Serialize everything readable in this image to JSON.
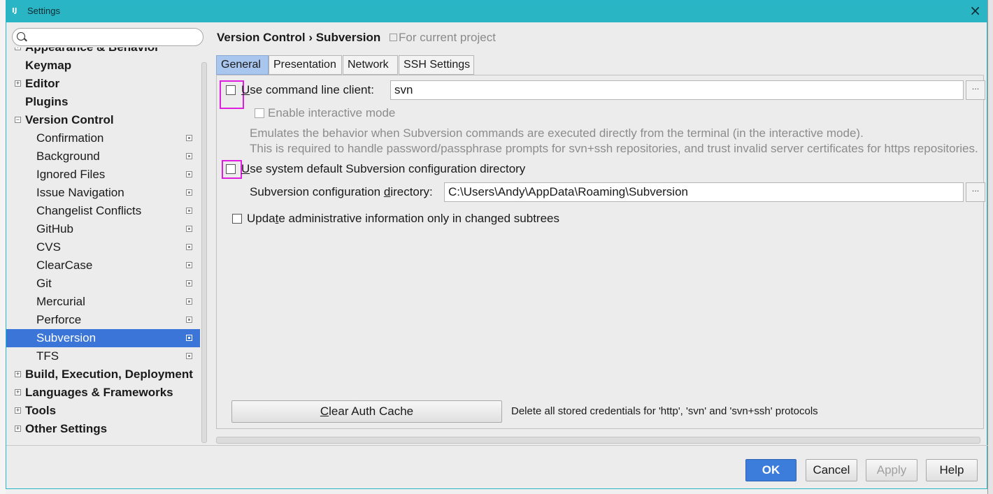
{
  "window": {
    "title": "Settings",
    "close": "×"
  },
  "search": {
    "placeholder": "",
    "value": ""
  },
  "tree": {
    "items": [
      {
        "label": "Appearance & Behavior",
        "bold": true,
        "expander": "+"
      },
      {
        "label": "Keymap",
        "bold": true
      },
      {
        "label": "Editor",
        "bold": true,
        "expander": "+"
      },
      {
        "label": "Plugins",
        "bold": true
      },
      {
        "label": "Version Control",
        "bold": true,
        "expander": "−"
      },
      {
        "label": "Confirmation"
      },
      {
        "label": "Background"
      },
      {
        "label": "Ignored Files"
      },
      {
        "label": "Issue Navigation"
      },
      {
        "label": "Changelist Conflicts"
      },
      {
        "label": "GitHub"
      },
      {
        "label": "CVS"
      },
      {
        "label": "ClearCase"
      },
      {
        "label": "Git"
      },
      {
        "label": "Mercurial"
      },
      {
        "label": "Perforce"
      },
      {
        "label": "Subversion",
        "selected": true
      },
      {
        "label": "TFS"
      },
      {
        "label": "Build, Execution, Deployment",
        "bold": true,
        "expander": "+"
      },
      {
        "label": "Languages & Frameworks",
        "bold": true,
        "expander": "+"
      },
      {
        "label": "Tools",
        "bold": true,
        "expander": "+"
      },
      {
        "label": "Other Settings",
        "bold": true,
        "expander": "+"
      }
    ]
  },
  "breadcrumb": {
    "parent": "Version Control",
    "separator": "›",
    "current": "Subversion",
    "scope": "For current project"
  },
  "tabs": [
    "General",
    "Presentation",
    "Network",
    "SSH Settings"
  ],
  "general": {
    "use_cmd_client": {
      "label_u": "U",
      "label_rest": "se command line client:",
      "checked": false,
      "value": "svn"
    },
    "interactive_mode": {
      "label": "Enable interactive mode",
      "checked": false,
      "enabled": false
    },
    "description_line1": "Emulates the behavior when Subversion commands are executed directly from the terminal (in the interactive mode).",
    "description_line2": "This is required to handle password/passphrase prompts for svn+ssh repositories, and trust invalid server certificates for https repositories.",
    "use_system_default": {
      "label_u": "U",
      "label_rest": "se system default Subversion configuration directory",
      "checked": false
    },
    "config_dir": {
      "label_pre": "Subversion configuration ",
      "label_u": "d",
      "label_post": "irectory:",
      "value": "C:\\Users\\Andy\\AppData\\Roaming\\Subversion"
    },
    "update_admin": {
      "label_pre": "Upda",
      "label_u": "t",
      "label_post": "e administrative information only in changed subtrees",
      "checked": false
    },
    "clear_cache": {
      "label_u": "C",
      "label_rest": "lear Auth Cache",
      "description": "Delete all stored credentials for 'http', 'svn' and 'svn+ssh' protocols"
    },
    "ellipsis": "..."
  },
  "buttons": {
    "ok": "OK",
    "cancel": "Cancel",
    "apply": "Apply",
    "help": "Help"
  }
}
